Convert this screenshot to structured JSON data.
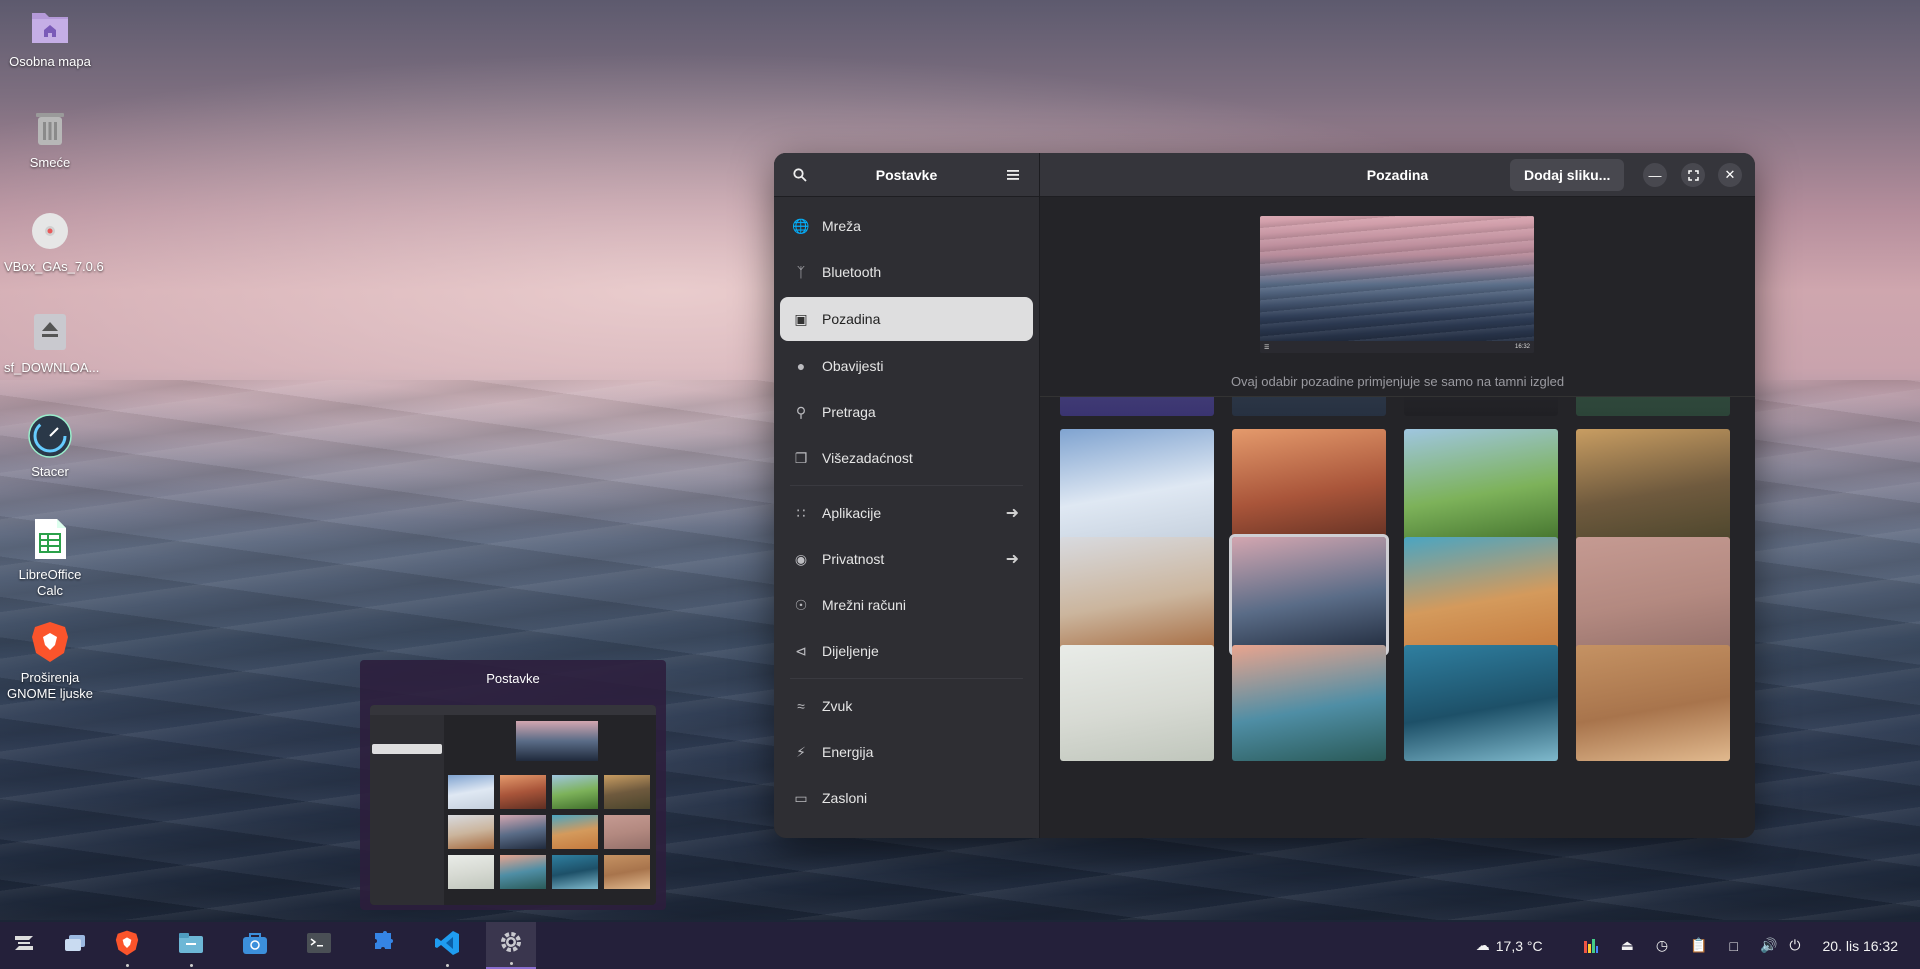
{
  "desktop": {
    "icons": [
      {
        "label": "Osobna mapa",
        "icon": "home-folder-icon"
      },
      {
        "label": "Smeće",
        "icon": "trash-icon"
      },
      {
        "label": "VBox_GAs_7.0.6",
        "icon": "disc-icon"
      },
      {
        "label": "sf_DOWNLOA...",
        "icon": "drive-icon"
      },
      {
        "label": "Stacer",
        "icon": "stacer-icon"
      },
      {
        "label": "LibreOffice Calc",
        "icon": "spreadsheet-icon"
      },
      {
        "label": "Proširenja GNOME ljuske",
        "icon": "brave-icon"
      }
    ]
  },
  "overview": {
    "title": "Postavke"
  },
  "settings": {
    "sidebar_title": "Postavke",
    "items": [
      {
        "label": "Mreža",
        "icon": "globe-icon"
      },
      {
        "label": "Bluetooth",
        "icon": "bluetooth-icon"
      },
      {
        "label": "Pozadina",
        "icon": "display-icon",
        "active": true
      },
      {
        "label": "Obavijesti",
        "icon": "bell-icon"
      },
      {
        "label": "Pretraga",
        "icon": "search-icon"
      },
      {
        "label": "Višezadaćnost",
        "icon": "multitask-icon"
      },
      {
        "label": "Aplikacije",
        "icon": "apps-grid-icon",
        "arrow": true
      },
      {
        "label": "Privatnost",
        "icon": "privacy-icon",
        "arrow": true
      },
      {
        "label": "Mrežni računi",
        "icon": "online-accounts-icon"
      },
      {
        "label": "Dijeljenje",
        "icon": "share-icon"
      },
      {
        "label": "Zvuk",
        "icon": "sound-icon"
      },
      {
        "label": "Energija",
        "icon": "power-icon"
      },
      {
        "label": "Zasloni",
        "icon": "monitor-icon"
      }
    ],
    "page_title": "Pozadina",
    "add_button": "Dodaj sliku...",
    "preview_time": "16:32",
    "note": "Ovaj odabir pozadine primjenjuje se samo na tamni izgled",
    "wallpapers": [
      {
        "name": "white-sand-dunes",
        "colors": [
          "#7fa3d0",
          "#dfe8f3",
          "#c4cfdc"
        ]
      },
      {
        "name": "orange-desert-dunes",
        "colors": [
          "#e49a6c",
          "#a9553a",
          "#5e2e22"
        ]
      },
      {
        "name": "green-hills",
        "colors": [
          "#9fc6e0",
          "#7db25a",
          "#41702c"
        ]
      },
      {
        "name": "monument-valley-sunset",
        "colors": [
          "#c89d62",
          "#6f5a3e",
          "#4b452c"
        ]
      },
      {
        "name": "desert-picnic",
        "colors": [
          "#d8dadf",
          "#cbb59d",
          "#a5693e"
        ]
      },
      {
        "name": "ocean-waves",
        "colors": [
          "#d3a6b0",
          "#5a6c87",
          "#202a3c"
        ],
        "selected": true
      },
      {
        "name": "coastal-sand-dune",
        "colors": [
          "#4aa5c2",
          "#d49a5c",
          "#c47a3e"
        ]
      },
      {
        "name": "stone-wall",
        "colors": [
          "#c59a92",
          "#b38980",
          "#94706a"
        ]
      },
      {
        "name": "white-blossoms",
        "colors": [
          "#e9ece8",
          "#d7dad3",
          "#c0c6bc"
        ]
      },
      {
        "name": "mountain-valley",
        "colors": [
          "#e9a48e",
          "#4f8ea5",
          "#2a5a58"
        ]
      },
      {
        "name": "aerial-ocean-rocks",
        "colors": [
          "#2f7fa0",
          "#1d5068",
          "#7fb9cc"
        ]
      },
      {
        "name": "sand-ripples",
        "colors": [
          "#c59263",
          "#a8744c",
          "#e1b98e"
        ]
      }
    ]
  },
  "taskbar": {
    "apps": [
      {
        "name": "zorin-menu-icon",
        "color": "#dcdcdc"
      },
      {
        "name": "workspaces-icon",
        "color": "#8fb6e6"
      },
      {
        "name": "brave-browser-icon",
        "color": "#fb542b"
      },
      {
        "name": "files-icon",
        "color": "#6db7d6"
      },
      {
        "name": "software-store-icon",
        "color": "#3c8fdb"
      },
      {
        "name": "terminal-icon",
        "color": "#4a4f55"
      },
      {
        "name": "extensions-icon",
        "color": "#3584e4"
      },
      {
        "name": "vscode-icon",
        "color": "#1f9cf0"
      },
      {
        "name": "settings-icon",
        "color": "#c9c9cf",
        "active": true
      }
    ],
    "weather": "17,3 °C",
    "clock": "20. lis 16:32"
  }
}
